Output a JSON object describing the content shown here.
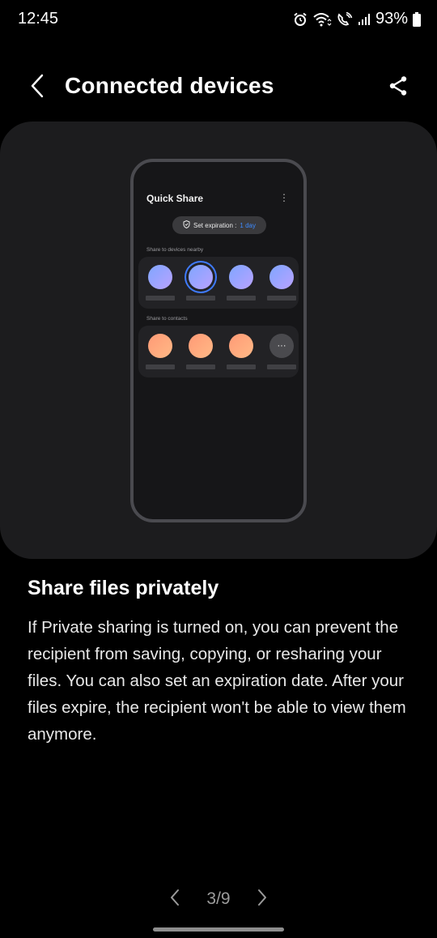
{
  "status_bar": {
    "time": "12:45",
    "battery": "93%",
    "icons": [
      "alarm-icon",
      "wifi-calling-icon",
      "volte-call-icon",
      "signal-icon",
      "battery-icon"
    ]
  },
  "header": {
    "title": "Connected devices",
    "back_icon": "chevron-left-icon",
    "share_icon": "share-icon"
  },
  "illustration": {
    "app_title": "Quick Share",
    "expiration_label": "Set expiration :",
    "expiration_value": "1 day",
    "section_devices": "Share to devices nearby",
    "section_contacts": "Share to contacts",
    "more_glyph": "···"
  },
  "content": {
    "heading": "Share files privately",
    "body": "If Private sharing is turned on, you can prevent the recipient from saving, copying, or resharing your files. You can also set an expiration date. After your files expire, the recipient won't be able to view them anymore."
  },
  "pager": {
    "label": "3/9"
  },
  "colors": {
    "background": "#000000",
    "card": "#1c1c1e",
    "accent": "#3e8bff"
  }
}
